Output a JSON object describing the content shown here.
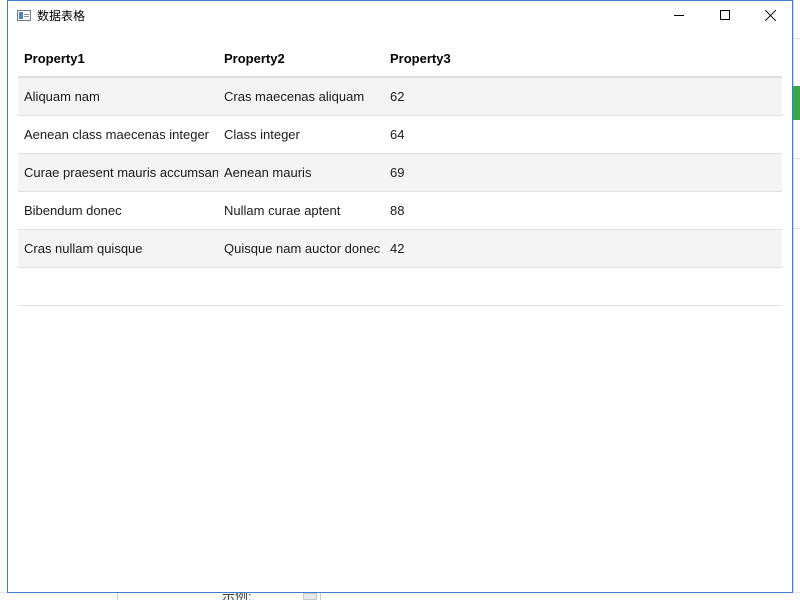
{
  "window": {
    "title": "数据表格"
  },
  "grid": {
    "columns": [
      "Property1",
      "Property2",
      "Property3"
    ],
    "rows": [
      [
        "Aliquam nam",
        "Cras maecenas aliquam",
        "62"
      ],
      [
        "Aenean class maecenas integer",
        "Class integer",
        "64"
      ],
      [
        "Curae praesent mauris accumsan",
        "Aenean mauris",
        "69"
      ],
      [
        "Bibendum donec",
        "Nullam curae aptent",
        "88"
      ],
      [
        "Cras nullam quisque",
        "Quisque nam auctor donec",
        "42"
      ]
    ]
  },
  "background_app": {
    "bottom_text": "示例:"
  },
  "colors": {
    "window_border": "#3c7fd1",
    "alt_row": "#f4f4f4",
    "accent_green": "#3aa845"
  },
  "icons": {
    "app": "window-app-icon",
    "minimize": "minimize-icon",
    "maximize": "maximize-icon",
    "close": "close-icon"
  }
}
